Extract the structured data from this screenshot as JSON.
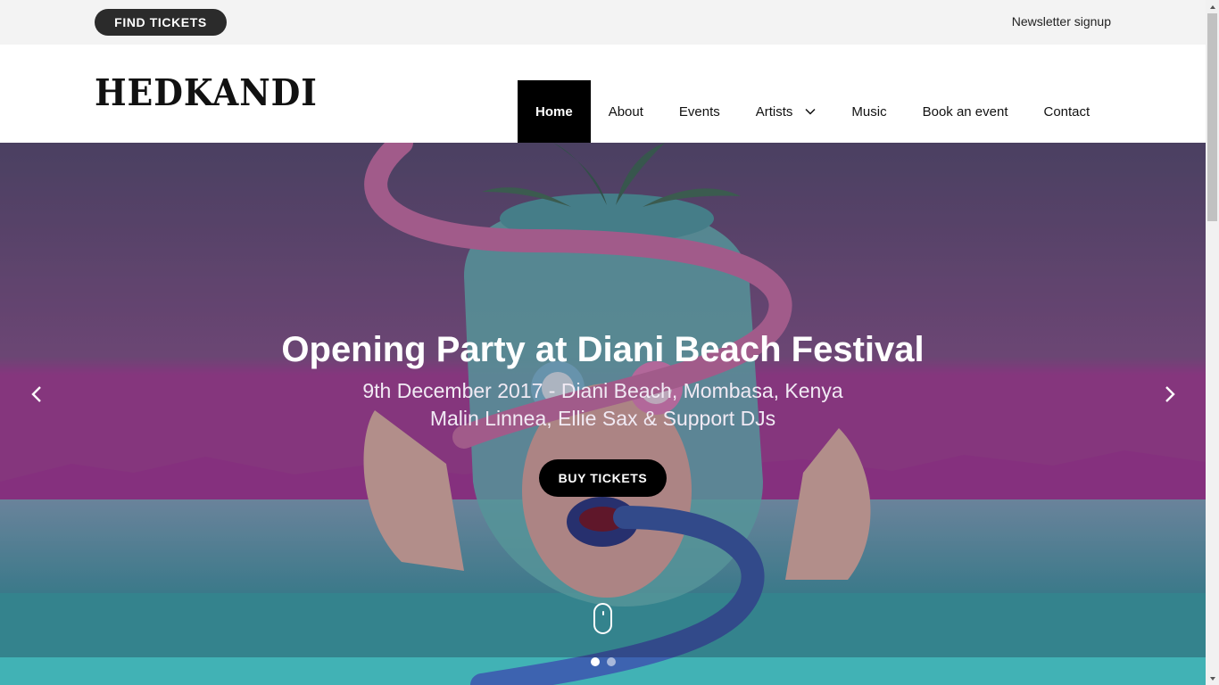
{
  "topbar": {
    "find_tickets": "FIND TICKETS",
    "newsletter": "Newsletter signup"
  },
  "brand": {
    "logo_text": "HEDKANDI"
  },
  "nav": {
    "items": [
      {
        "label": "Home",
        "active": true
      },
      {
        "label": "About"
      },
      {
        "label": "Events"
      },
      {
        "label": "Artists",
        "has_dropdown": true
      },
      {
        "label": "Music"
      },
      {
        "label": "Book an event"
      },
      {
        "label": "Contact"
      }
    ]
  },
  "hero": {
    "title": "Opening Party at Diani Beach Festival",
    "subtitle_line1": "9th December 2017 - Diani Beach, Mombasa, Kenya",
    "subtitle_line2": "Malin Linnea, Ellie Sax & Support DJs",
    "cta": "BUY TICKETS",
    "slides_total": 2,
    "active_slide": 1,
    "icons": {
      "prev": "chevron-left-icon",
      "next": "chevron-right-icon",
      "scroll": "mouse-scroll-icon"
    }
  },
  "colors": {
    "topbar_bg": "#f3f3f3",
    "nav_active_bg": "#000000",
    "button_dark": "#2b2b2b",
    "hero_purple": "#7b5a8a",
    "hero_teal": "#3aa6a5"
  }
}
